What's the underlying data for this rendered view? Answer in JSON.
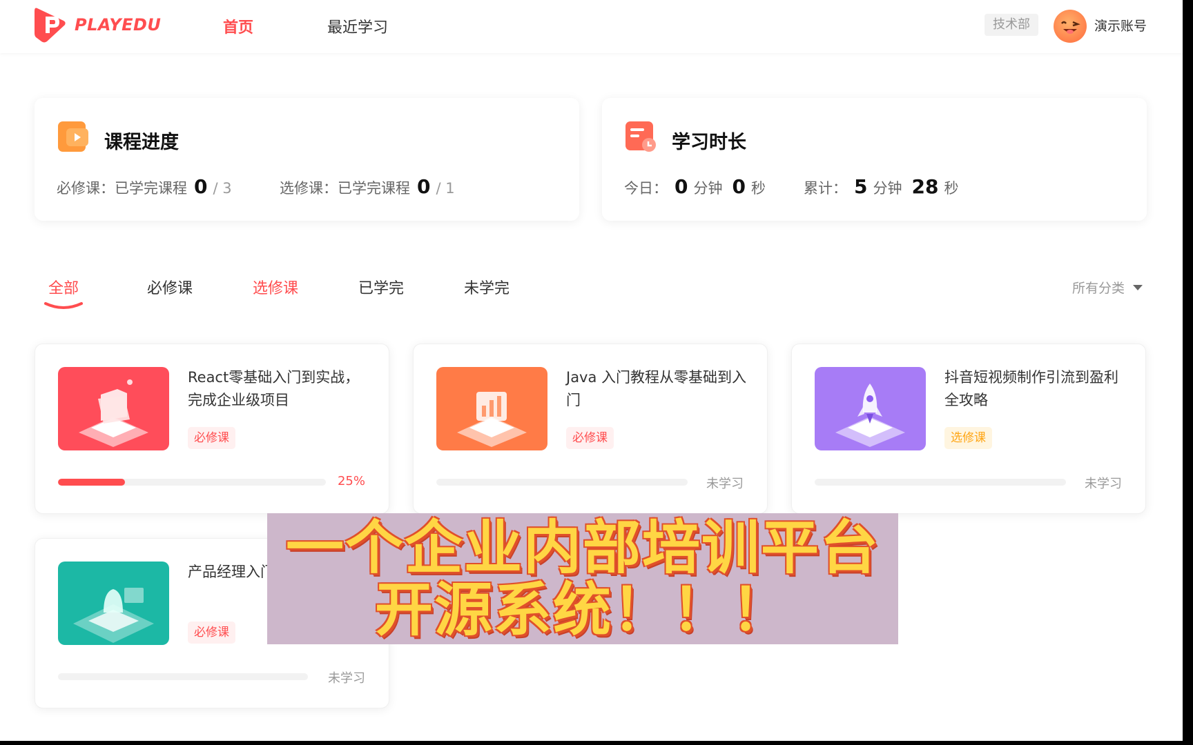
{
  "header": {
    "logo_text": "PLAYEDU",
    "nav": [
      "首页",
      "最近学习"
    ],
    "department": "技术部",
    "user_name": "演示账号"
  },
  "stats": {
    "course": {
      "title": "课程进度",
      "required_label": "必修课：已学完课程",
      "required_done": "0",
      "required_total": "/ 3",
      "optional_label": "选修课：已学完课程",
      "optional_done": "0",
      "optional_total": "/ 1"
    },
    "time": {
      "title": "学习时长",
      "today_label": "今日：",
      "today_min": "0",
      "today_sec": "0",
      "total_label": "累计：",
      "total_min": "5",
      "total_sec": "28",
      "min_unit": "分钟",
      "sec_unit": "秒"
    }
  },
  "tabs": [
    "全部",
    "必修课",
    "选修课",
    "已学完",
    "未学完"
  ],
  "filter_label": "所有分类",
  "courses": [
    {
      "title": "React零基础入门到实战，完成企业级项目",
      "tag": "必修课",
      "tag_type": "required",
      "progress": 0.25,
      "progress_text": "25%",
      "cover_color": "#ff4d5a"
    },
    {
      "title": "Java 入门教程从零基础到入门",
      "tag": "必修课",
      "tag_type": "required",
      "progress": 0,
      "progress_text": "未学习",
      "cover_color": "#ff7b47"
    },
    {
      "title": "抖音短视频制作引流到盈利全攻略",
      "tag": "选修课",
      "tag_type": "optional",
      "progress": 0,
      "progress_text": "未学习",
      "cover_color": "#a77cf6"
    },
    {
      "title": "产品经理入门",
      "tag": "必修课",
      "tag_type": "required",
      "progress": 0,
      "progress_text": "未学习",
      "cover_color": "#1cb8a5"
    }
  ],
  "banner": {
    "line1": "一个企业内部培训平台",
    "line2": "开源系统！！！"
  },
  "colors": {
    "brand": "#ff4d4f",
    "optional": "#ffa514"
  }
}
